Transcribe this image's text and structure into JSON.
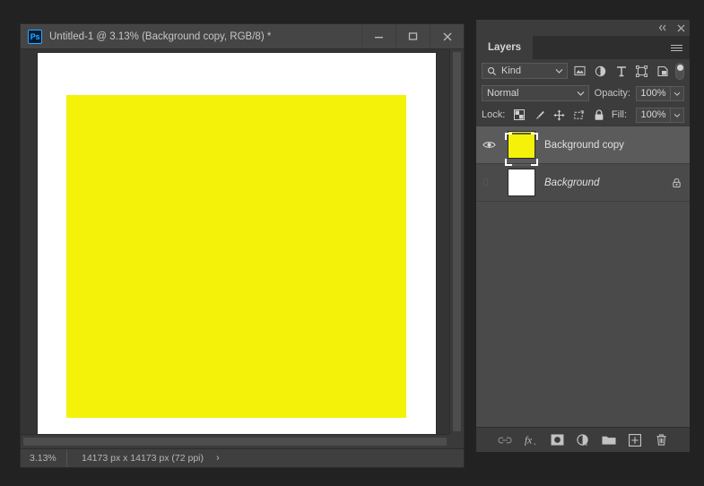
{
  "document_window": {
    "app_icon": "photoshop-ps-icon",
    "title": "Untitled-1 @ 3.13% (Background copy, RGB/8) *",
    "window_controls": [
      {
        "name": "minimize",
        "glyph": "minimize-icon"
      },
      {
        "name": "maximize",
        "glyph": "maximize-icon"
      },
      {
        "name": "close",
        "glyph": "close-icon"
      }
    ],
    "statusbar": {
      "zoom": "3.13%",
      "dimensions": "14173 px x 14173 px (72 ppi)",
      "arrow": "›"
    },
    "canvas": {
      "sheet_color": "#ffffff",
      "fill_color": "#f5f20a"
    }
  },
  "panel": {
    "collapse_icon": "double-chevron-left-icon",
    "close_icon": "close-icon",
    "tab_label": "Layers",
    "menu_icon": "panel-menu-icon",
    "filter": {
      "search_icon": "search-icon",
      "kind_label": "Kind",
      "chevron": "chevron-down-icon",
      "type_filters": [
        {
          "name": "filter-pixel",
          "icon": "image-icon"
        },
        {
          "name": "filter-adjustment",
          "icon": "adjustment-icon"
        },
        {
          "name": "filter-type",
          "icon": "type-icon"
        },
        {
          "name": "filter-shape",
          "icon": "shape-icon"
        },
        {
          "name": "filter-smart-object",
          "icon": "smart-object-icon"
        }
      ],
      "toggle_name": "filter-enable-toggle"
    },
    "blend": {
      "mode": "Normal",
      "opacity_label": "Opacity:",
      "opacity_value": "100%",
      "fill_label": "Fill:",
      "fill_value": "100%"
    },
    "lock": {
      "label": "Lock:",
      "items": [
        {
          "name": "lock-transparent-pixels",
          "icon": "checkerboard-icon"
        },
        {
          "name": "lock-image-pixels",
          "icon": "brush-icon"
        },
        {
          "name": "lock-position",
          "icon": "move-arrows-icon"
        },
        {
          "name": "lock-artboard-nesting",
          "icon": "artboard-icon"
        },
        {
          "name": "lock-all",
          "icon": "lock-icon"
        }
      ]
    },
    "layers": [
      {
        "name": "Background copy",
        "selected": true,
        "visible": true,
        "italic": false,
        "locked": false,
        "thumb_color": "#f5f20a"
      },
      {
        "name": "Background",
        "selected": false,
        "visible": false,
        "italic": true,
        "locked": true,
        "thumb_color": "#ffffff"
      }
    ],
    "footer_buttons": [
      {
        "name": "link-layers-button",
        "icon": "link-icon"
      },
      {
        "name": "layer-style-button",
        "icon": "fx-icon"
      },
      {
        "name": "add-layer-mask-button",
        "icon": "mask-icon"
      },
      {
        "name": "new-adjustment-layer-button",
        "icon": "adjustment-icon"
      },
      {
        "name": "new-group-button",
        "icon": "folder-icon"
      },
      {
        "name": "new-layer-button",
        "icon": "plus-square-icon"
      },
      {
        "name": "delete-layer-button",
        "icon": "trash-icon"
      }
    ]
  }
}
